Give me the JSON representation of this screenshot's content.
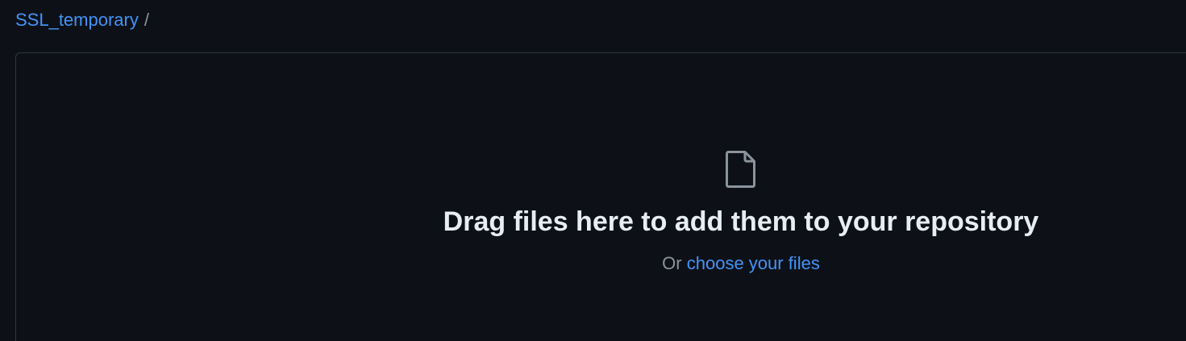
{
  "breadcrumb": {
    "repo": "SSL_temporary",
    "separator": "/"
  },
  "dropzone": {
    "icon": "file-icon",
    "title": "Drag files here to add them to your repository",
    "sub_prefix": "Or",
    "sub_link": "choose your files"
  },
  "colors": {
    "background": "#0d1117",
    "link": "#4493f8",
    "title": "#e6edf3",
    "muted": "#8b949e",
    "border": "#30363d"
  }
}
